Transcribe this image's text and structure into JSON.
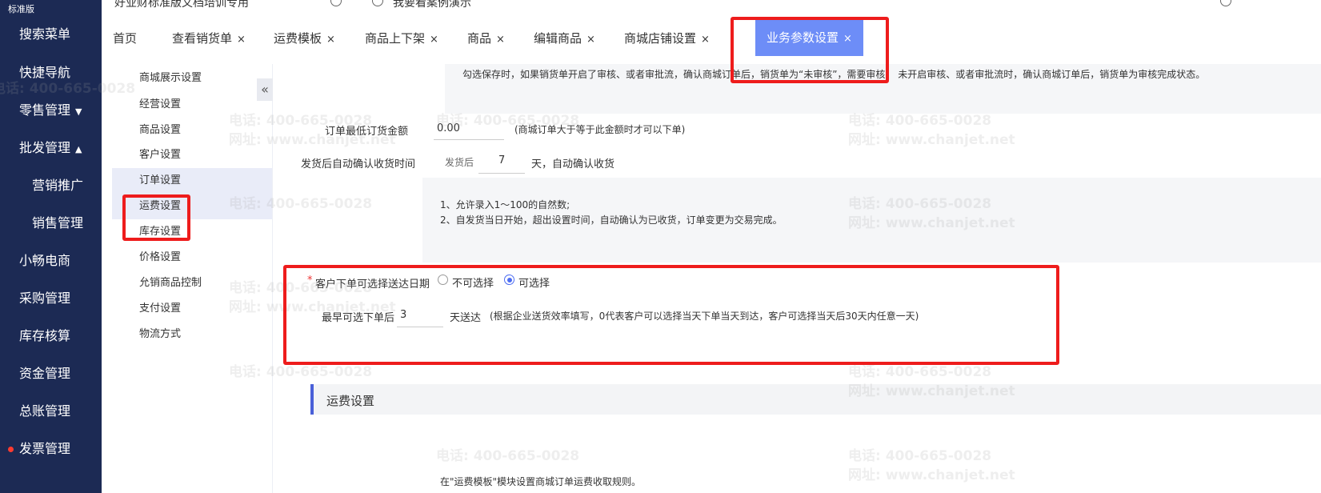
{
  "app": {
    "edition": "标准版",
    "org_name": "好业财标准版文档培训专用",
    "demo_text": "我要看案例演示"
  },
  "leftnav": {
    "items": [
      {
        "label": "搜索菜单"
      },
      {
        "label": "快捷导航"
      },
      {
        "label": "零售管理",
        "caret": "▼"
      },
      {
        "label": "批发管理",
        "caret": "▲"
      },
      {
        "label": "营销推广"
      },
      {
        "label": "销售管理"
      },
      {
        "label": "小畅电商"
      },
      {
        "label": "采购管理"
      },
      {
        "label": "库存核算"
      },
      {
        "label": "资金管理"
      },
      {
        "label": "总账管理"
      },
      {
        "label": "发票管理"
      }
    ]
  },
  "tabs": [
    {
      "label": "首页"
    },
    {
      "label": "查看销货单",
      "close": "×"
    },
    {
      "label": "运费模板",
      "close": "×"
    },
    {
      "label": "商品上下架",
      "close": "×"
    },
    {
      "label": "商品",
      "close": "×"
    },
    {
      "label": "编辑商品",
      "close": "×"
    },
    {
      "label": "商城店铺设置",
      "close": "×"
    },
    {
      "label": "业务参数设置",
      "close": "×"
    }
  ],
  "subside": {
    "collapse_icon": "«",
    "items": [
      {
        "label": "商城展示设置"
      },
      {
        "label": "经营设置"
      },
      {
        "label": "商品设置"
      },
      {
        "label": "客户设置"
      },
      {
        "label": "订单设置"
      },
      {
        "label": "运费设置"
      },
      {
        "label": "库存设置"
      },
      {
        "label": "价格设置"
      },
      {
        "label": "允销商品控制"
      },
      {
        "label": "支付设置"
      },
      {
        "label": "物流方式"
      }
    ]
  },
  "main": {
    "audit_note": "勾选保存时，如果销货单开启了审核、或者审批流，确认商城订单后，销货单为“未审核”，需要审核。 未开启审核、或者审批流时，确认商城订单后，销货单为审核完成状态。",
    "min_amount": {
      "label": "订单最低订货金额",
      "value": "0.00",
      "hint": "(商城订单大于等于此金额时才可以下单)"
    },
    "auto_confirm": {
      "label": "发货后自动确认收货时间",
      "prefix": "发货后",
      "value": "7",
      "suffix": "天，自动确认收货",
      "note1": "1、允许录入1～100的自然数;",
      "note2": "2、自发货当日开始，超出设置时间，自动确认为已收货，订单变更为交易完成。"
    },
    "delivery_date": {
      "required_mark": "*",
      "label": "客户下单可选择送达日期",
      "option_no": "不可选择",
      "option_yes": "可选择",
      "selected": "可选择",
      "earliest_label": "最早可选下单后",
      "earliest_value": "3",
      "earliest_suffix": "天送达",
      "earliest_hint": "(根据企业送货效率填写，0代表客户可以选择当天下单当天到达，客户可选择当天后30天内任意一天)"
    },
    "freight_section": {
      "title": "运费设置",
      "note": "在\"运费模板\"模块设置商城订单运费收取规则。"
    }
  },
  "watermark": {
    "phone": "电话: 400-665-0028",
    "site": "网址: www.chanjet.net"
  },
  "colors": {
    "nav_bg": "#1c2a54",
    "active_tab": "#6d8df7",
    "radio_on": "#4e6ef2",
    "annotation_red": "#ee1c1c"
  }
}
